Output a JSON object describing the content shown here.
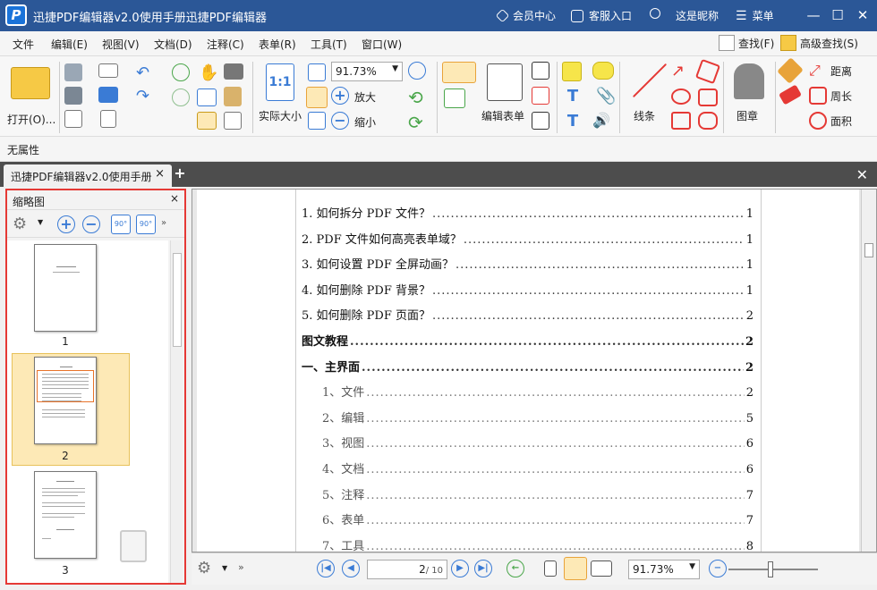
{
  "app": {
    "title": "迅捷PDF编辑器v2.0使用手册迅捷PDF编辑器",
    "logo_letter": "P",
    "member_center": "会员中心",
    "customer_service": "客服入口",
    "nickname": "这是昵称",
    "menu_label": "菜单"
  },
  "menu": {
    "items": [
      "文件",
      "编辑(E)",
      "视图(V)",
      "文档(D)",
      "注释(C)",
      "表单(R)",
      "工具(T)",
      "窗口(W)"
    ],
    "find": "查找(F)",
    "advanced_find": "高级查找(S)"
  },
  "toolbar": {
    "open": "打开(O)...",
    "actual_size": "实际大小",
    "actual_size_icon_text": "1:1",
    "zoom_value": "91.73%",
    "zoom_in": "放大",
    "zoom_out": "缩小",
    "edit_form": "编辑表单",
    "line": "线条",
    "stamp": "图章",
    "distance": "距离",
    "perimeter": "周长",
    "area": "面积"
  },
  "property_bar": {
    "label": "无属性"
  },
  "tabs": [
    {
      "label": "迅捷PDF编辑器v2.0使用手册"
    }
  ],
  "thumbnail_panel": {
    "title": "缩略图",
    "pages": [
      "1",
      "2",
      "3"
    ],
    "selected_page": "2"
  },
  "document": {
    "toc": [
      {
        "title": "1.  如何拆分 PDF 文件？",
        "page": "1",
        "style": "normal"
      },
      {
        "title": "2.  PDF 文件如何高亮表单域？",
        "page": "1",
        "style": "normal"
      },
      {
        "title": "3.  如何设置 PDF 全屏动画？",
        "page": "1",
        "style": "normal"
      },
      {
        "title": "4.  如何删除 PDF 背景？",
        "page": "1",
        "style": "normal"
      },
      {
        "title": "5.  如何删除 PDF 页面？",
        "page": "2",
        "style": "normal"
      },
      {
        "title": "图文教程",
        "page": "2",
        "style": "bold"
      },
      {
        "title": "一、主界面",
        "page": "2",
        "style": "bold"
      },
      {
        "title": "1、文件",
        "page": "2",
        "style": "sub"
      },
      {
        "title": "2、编辑",
        "page": "5",
        "style": "sub"
      },
      {
        "title": "3、视图",
        "page": "6",
        "style": "sub"
      },
      {
        "title": "4、文档",
        "page": "6",
        "style": "sub"
      },
      {
        "title": "5、注释",
        "page": "7",
        "style": "sub"
      },
      {
        "title": "6、表单",
        "page": "7",
        "style": "sub"
      },
      {
        "title": "7、工具",
        "page": "8",
        "style": "sub"
      }
    ]
  },
  "navbar": {
    "current_page": "2",
    "total_pages": "/ 10",
    "zoom_value": "91.73%"
  },
  "colors": {
    "titlebar": "#2b5797",
    "accent": "#3a7bd5",
    "highlight_border": "#e53935",
    "selected_thumb": "#fde9b6"
  }
}
